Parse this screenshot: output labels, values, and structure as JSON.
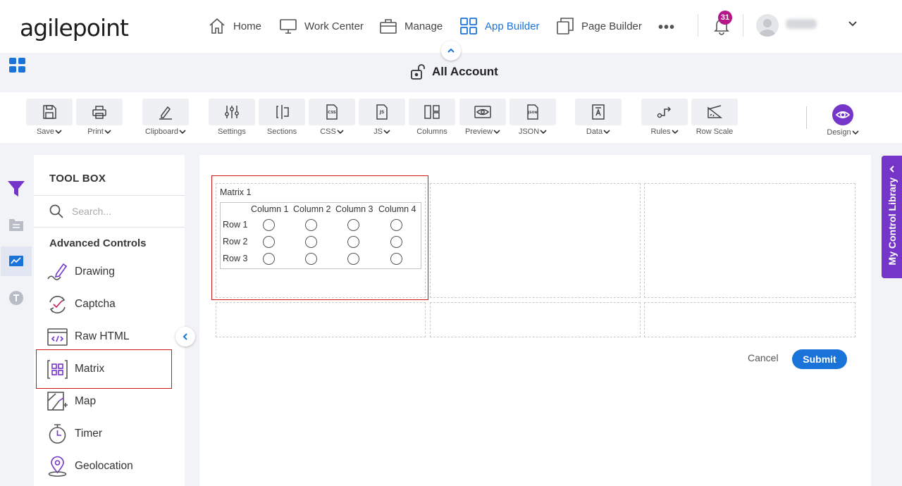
{
  "brand": {
    "logo": "agilepoint"
  },
  "nav": {
    "items": [
      {
        "label": "Home",
        "icon": "home-icon"
      },
      {
        "label": "Work Center",
        "icon": "monitor-icon"
      },
      {
        "label": "Manage",
        "icon": "briefcase-icon"
      },
      {
        "label": "App Builder",
        "icon": "apps-grid-icon",
        "active": true
      },
      {
        "label": "Page Builder",
        "icon": "pages-icon"
      }
    ],
    "more": "•••",
    "notifications_count": "31"
  },
  "page": {
    "title": "All Account"
  },
  "toolbar": {
    "items": [
      {
        "label": "Save",
        "icon": "save-icon",
        "dropdown": true
      },
      {
        "label": "Print",
        "icon": "print-icon",
        "dropdown": true
      },
      {
        "label": "Clipboard",
        "icon": "clipboard-icon",
        "dropdown": true
      },
      {
        "label": "Settings",
        "icon": "settings-icon",
        "dropdown": false
      },
      {
        "label": "Sections",
        "icon": "sections-icon",
        "dropdown": false
      },
      {
        "label": "CSS",
        "icon": "css-icon",
        "dropdown": true
      },
      {
        "label": "JS",
        "icon": "js-icon",
        "dropdown": true
      },
      {
        "label": "Columns",
        "icon": "columns-icon",
        "dropdown": false
      },
      {
        "label": "Preview",
        "icon": "preview-icon",
        "dropdown": true
      },
      {
        "label": "JSON",
        "icon": "json-icon",
        "dropdown": true
      },
      {
        "label": "Data",
        "icon": "data-icon",
        "dropdown": true
      },
      {
        "label": "Rules",
        "icon": "rules-icon",
        "dropdown": true
      },
      {
        "label": "Row Scale",
        "icon": "row-scale-icon",
        "dropdown": false
      }
    ],
    "design_label": "Design"
  },
  "toolbox": {
    "heading": "TOOL BOX",
    "search_placeholder": "Search...",
    "section": "Advanced Controls",
    "controls": [
      {
        "label": "Drawing",
        "icon": "drawing-icon"
      },
      {
        "label": "Captcha",
        "icon": "captcha-icon"
      },
      {
        "label": "Raw HTML",
        "icon": "raw-html-icon"
      },
      {
        "label": "Matrix",
        "icon": "matrix-icon",
        "selected": true
      },
      {
        "label": "Map",
        "icon": "map-icon"
      },
      {
        "label": "Timer",
        "icon": "timer-icon"
      },
      {
        "label": "Geolocation",
        "icon": "geolocation-icon"
      }
    ]
  },
  "matrix": {
    "title": "Matrix 1",
    "columns": [
      "Column 1",
      "Column 2",
      "Column 3",
      "Column 4"
    ],
    "rows": [
      "Row 1",
      "Row 2",
      "Row 3"
    ]
  },
  "form": {
    "cancel_label": "Cancel",
    "submit_label": "Submit"
  },
  "library": {
    "label": "My Control Library"
  },
  "colors": {
    "accent": "#1a73d9",
    "purple": "#7435c8",
    "highlight": "#d01818",
    "badge": "#b5178a"
  }
}
